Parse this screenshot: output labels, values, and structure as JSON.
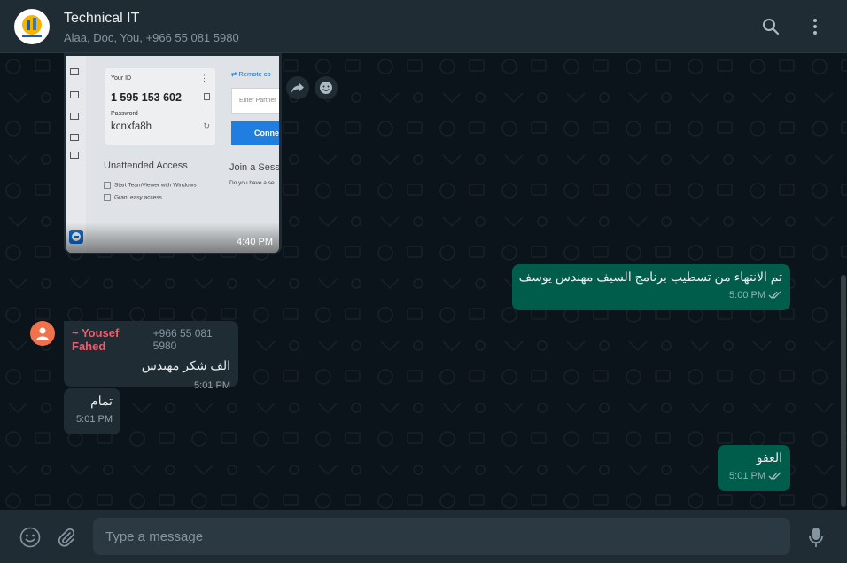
{
  "header": {
    "title": "Technical IT",
    "subtitle": "Alaa, Doc, You, +966 55 081 5980",
    "search_icon": "search-icon",
    "menu_icon": "kebab-menu-icon"
  },
  "image_message": {
    "time": "4:40 PM",
    "screenshot": {
      "your_id_label": "Your ID",
      "your_id_value": "1 595 153 602",
      "password_label": "Password",
      "password_value": "kcnxfa8h",
      "remote_control_label": "Remote co",
      "partner_placeholder": "Enter Partner",
      "connect_label": "Conne",
      "unattended_title": "Unattended Access",
      "start_with_windows": "Start TeamViewer with Windows",
      "grant_easy_access": "Grant easy access",
      "join_session": "Join a Sess",
      "join_session_sub": "Do you have a se"
    }
  },
  "messages": [
    {
      "id": "m1",
      "direction": "out",
      "text": "تم الانتهاء من تسطيب برنامج السيف مهندس يوسف",
      "time": "5:00 PM"
    },
    {
      "id": "m2",
      "direction": "in",
      "sender": "~ Yousef Fahed",
      "phone": "+966 55 081 5980",
      "text": "الف شكر مهندس",
      "time": "5:01 PM"
    },
    {
      "id": "m3",
      "direction": "in",
      "text": "تمام",
      "time": "5:01 PM"
    },
    {
      "id": "m4",
      "direction": "out",
      "text": "العفو",
      "time": "5:01 PM"
    }
  ],
  "composer": {
    "placeholder": "Type a message"
  },
  "colors": {
    "outgoing_bubble": "#005c4b",
    "incoming_bubble": "#202c33",
    "header": "#202c33",
    "background": "#0b141a",
    "sender_name": "#f15c6d"
  }
}
